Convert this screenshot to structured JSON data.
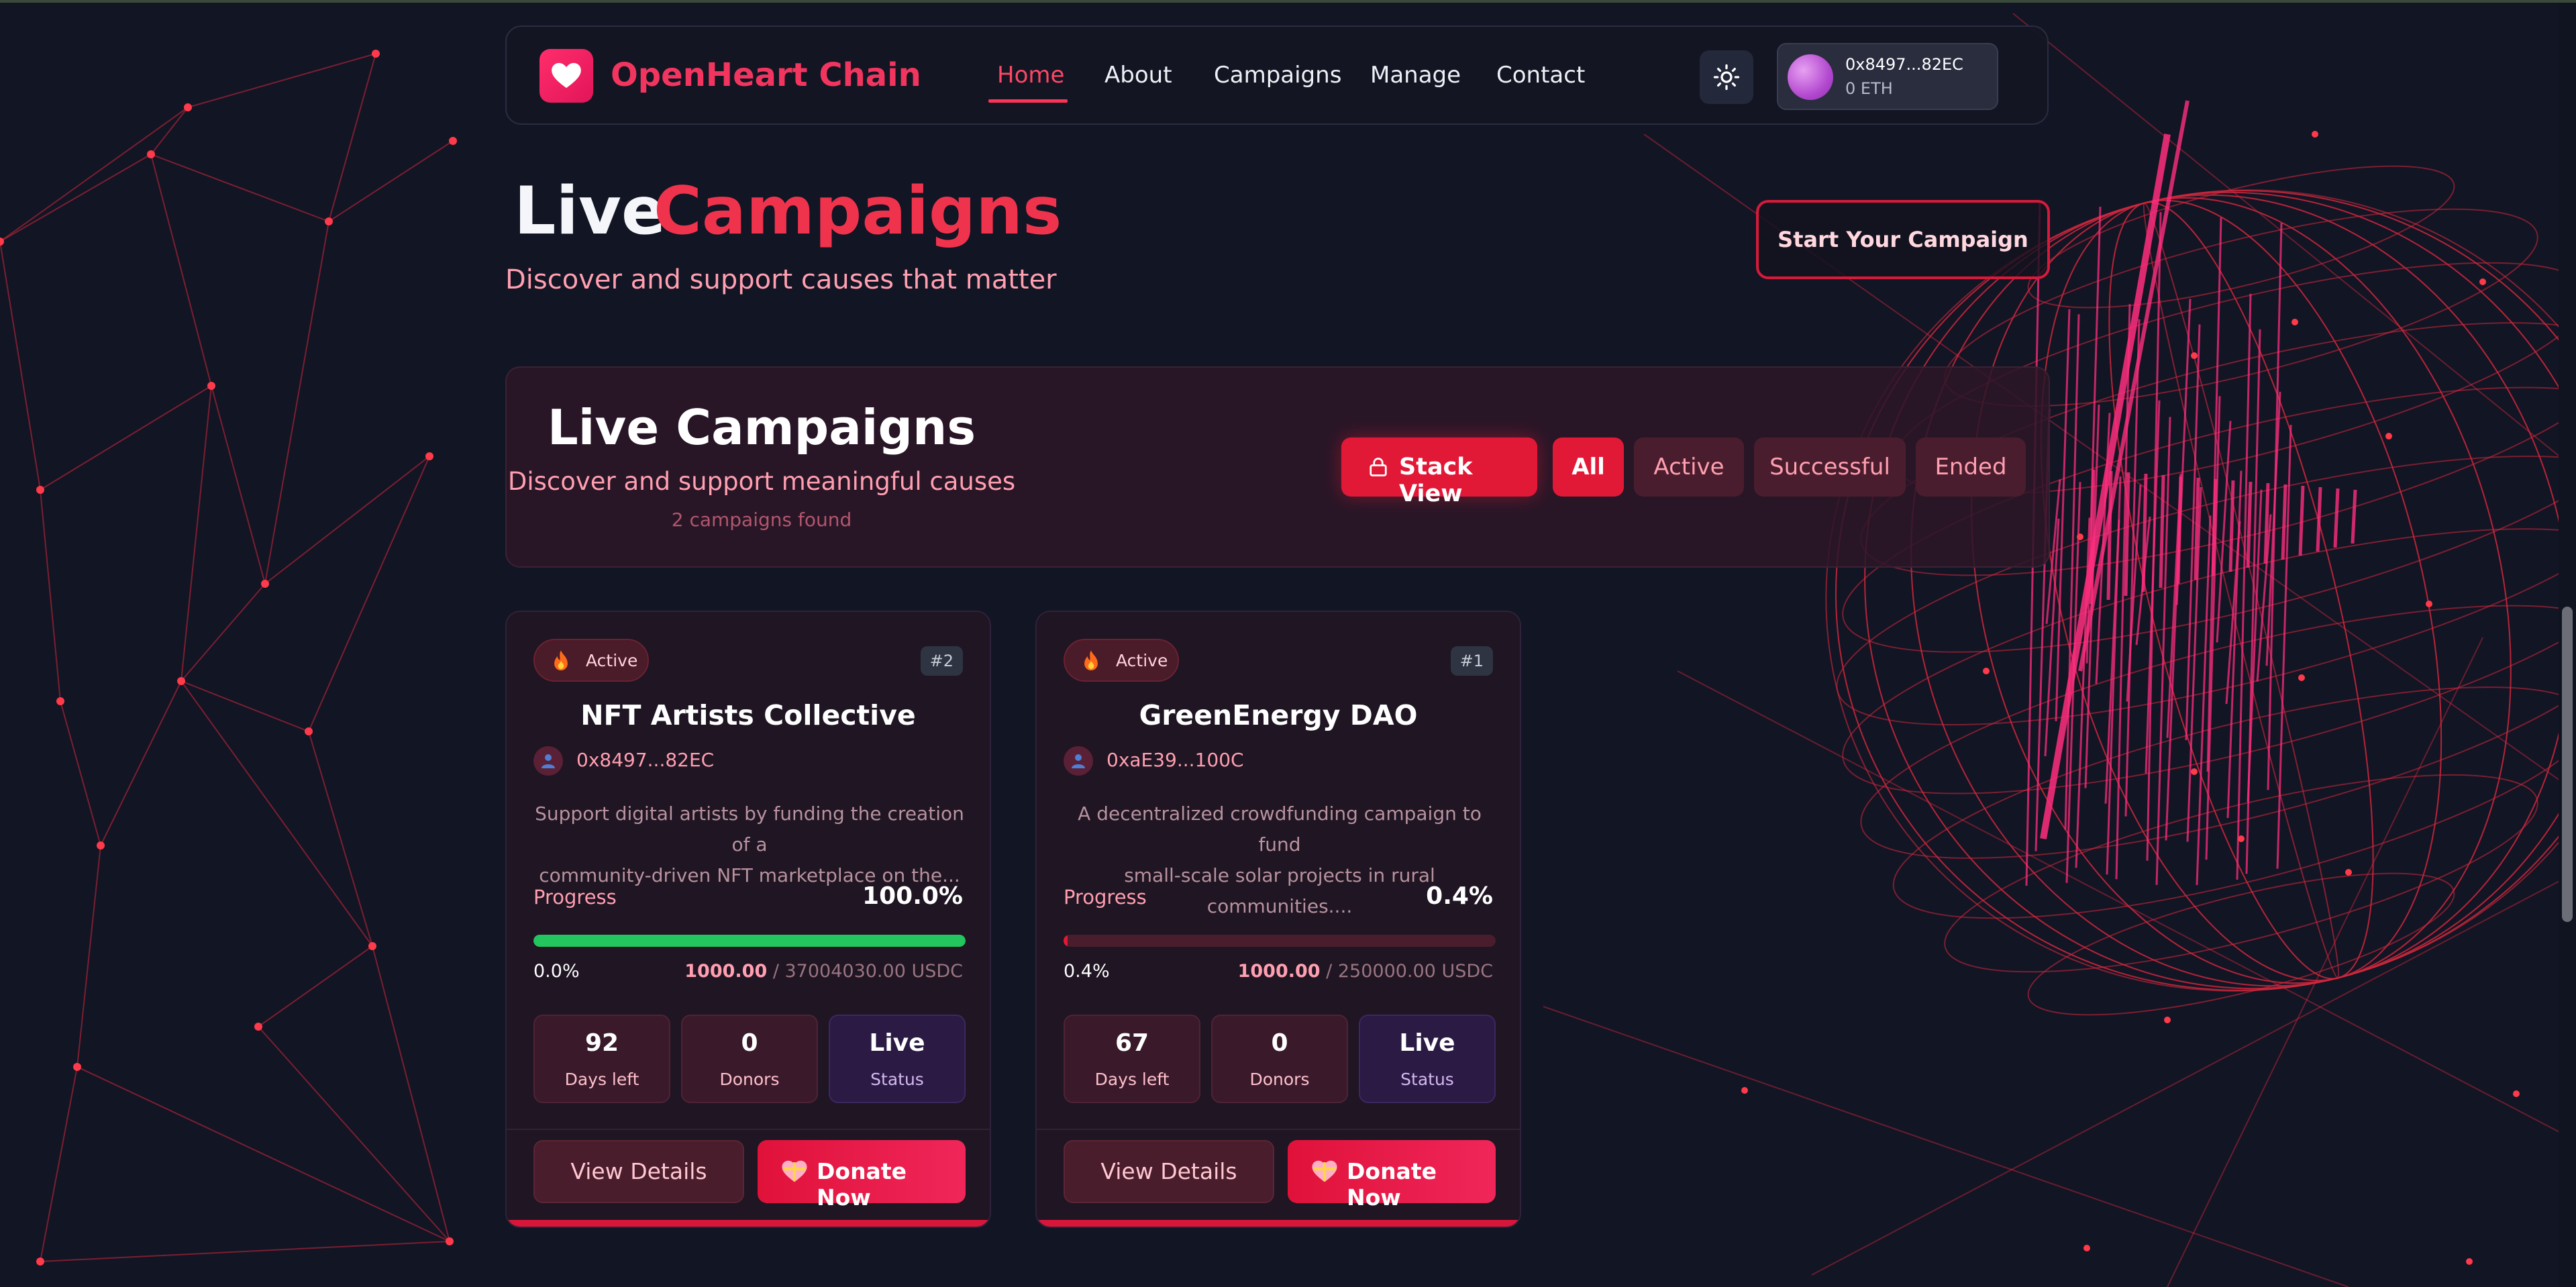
{
  "nav": {
    "brand": "OpenHeart Chain",
    "links": [
      "Home",
      "About",
      "Campaigns",
      "Manage",
      "Contact"
    ],
    "active_link": "Home",
    "wallet": {
      "address": "0x8497...82EC",
      "balance": "0 ETH"
    }
  },
  "hero": {
    "title_word_1": "Live",
    "title_word_2": "Campaigns",
    "subtitle": "Discover and support causes that matter",
    "start_button": "Start Your Campaign"
  },
  "panel": {
    "title": "Live Campaigns",
    "subtitle": "Discover and support meaningful causes",
    "count": "2 campaigns found",
    "stack_view": "Stack View",
    "filters": [
      "All",
      "Active",
      "Successful",
      "Ended"
    ],
    "selected_filter": "All"
  },
  "campaigns": [
    {
      "status_badge": "Active",
      "rank": "#2",
      "title": "NFT Artists Collective",
      "owner": "0x8497...82EC",
      "description_line_1": "Support digital artists by funding the creation of a",
      "description_line_2": "community-driven NFT marketplace on the...",
      "progress_label": "Progress",
      "progress_pct": "100.0%",
      "progress_fraction": 1.0,
      "raised_pct": "0.0%",
      "raised": "1000.00",
      "goal": "/ 37004030.00 USDC",
      "stats": [
        {
          "value": "92",
          "label": "Days left"
        },
        {
          "value": "0",
          "label": "Donors"
        },
        {
          "value": "Live",
          "label": "Status"
        }
      ],
      "view_button": "View Details",
      "donate_button": "Donate Now"
    },
    {
      "status_badge": "Active",
      "rank": "#1",
      "title": "GreenEnergy DAO",
      "owner": "0xaE39...100C",
      "description_line_1": "A decentralized crowdfunding campaign to fund",
      "description_line_2": "small-scale solar projects in rural communities....",
      "progress_label": "Progress",
      "progress_pct": "0.4%",
      "progress_fraction": 0.004,
      "raised_pct": "0.4%",
      "raised": "1000.00",
      "goal": "/ 250000.00 USDC",
      "stats": [
        {
          "value": "67",
          "label": "Days left"
        },
        {
          "value": "0",
          "label": "Donors"
        },
        {
          "value": "Live",
          "label": "Status"
        }
      ],
      "view_button": "View Details",
      "donate_button": "Donate Now"
    }
  ],
  "colors": {
    "background": "#121524",
    "accent": "#e21837",
    "brand": "#f2355f",
    "progress_full": "#22c55e",
    "mesh": "#d0283d"
  }
}
